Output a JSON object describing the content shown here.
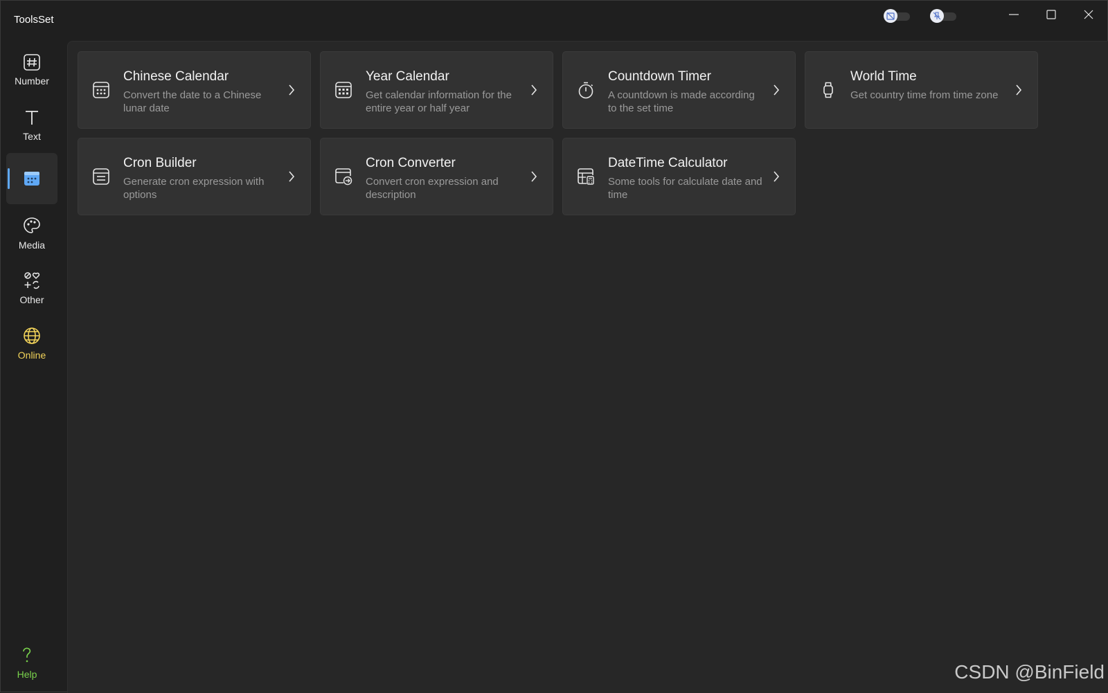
{
  "app": {
    "title": "ToolsSet"
  },
  "titlebar": {
    "toggles": [
      {
        "icon": "calendar-off-icon"
      },
      {
        "icon": "pin-off-icon"
      }
    ],
    "buttons": [
      "minimize-icon",
      "maximize-icon",
      "close-icon"
    ]
  },
  "sidebar": {
    "items": [
      {
        "label": "Number",
        "icon": "hash-icon"
      },
      {
        "label": "Text",
        "icon": "text-t-icon"
      },
      {
        "label": "",
        "icon": "calendar-icon",
        "active": true
      },
      {
        "label": "Media",
        "icon": "palette-icon"
      },
      {
        "label": "Other",
        "icon": "shapes-icon"
      },
      {
        "label": "Online",
        "icon": "globe-icon"
      }
    ],
    "help": {
      "label": "Help",
      "icon": "question-icon"
    }
  },
  "cards": [
    {
      "title": "Chinese Calendar",
      "desc": "Convert the date to a Chinese lunar date",
      "icon": "calendar-grid-icon"
    },
    {
      "title": "Year Calendar",
      "desc": "Get calendar information for the entire year or half year",
      "icon": "calendar-month-icon"
    },
    {
      "title": "Countdown Timer",
      "desc": "A countdown is made according to the set time",
      "icon": "stopwatch-icon"
    },
    {
      "title": "World Time",
      "desc": "Get country time from time zone",
      "icon": "watch-icon"
    },
    {
      "title": "Cron Builder",
      "desc": "Generate cron expression with options",
      "icon": "cron-builder-icon"
    },
    {
      "title": "Cron Converter",
      "desc": "Convert cron expression and description",
      "icon": "calendar-arrow-icon"
    },
    {
      "title": "DateTime Calculator",
      "desc": "Some tools for calculate date and time",
      "icon": "table-calculator-icon"
    }
  ],
  "watermark": "CSDN @BinField",
  "colors": {
    "accent": "#5fa8f5",
    "online": "#f3d45a",
    "help": "#7ad34c"
  }
}
